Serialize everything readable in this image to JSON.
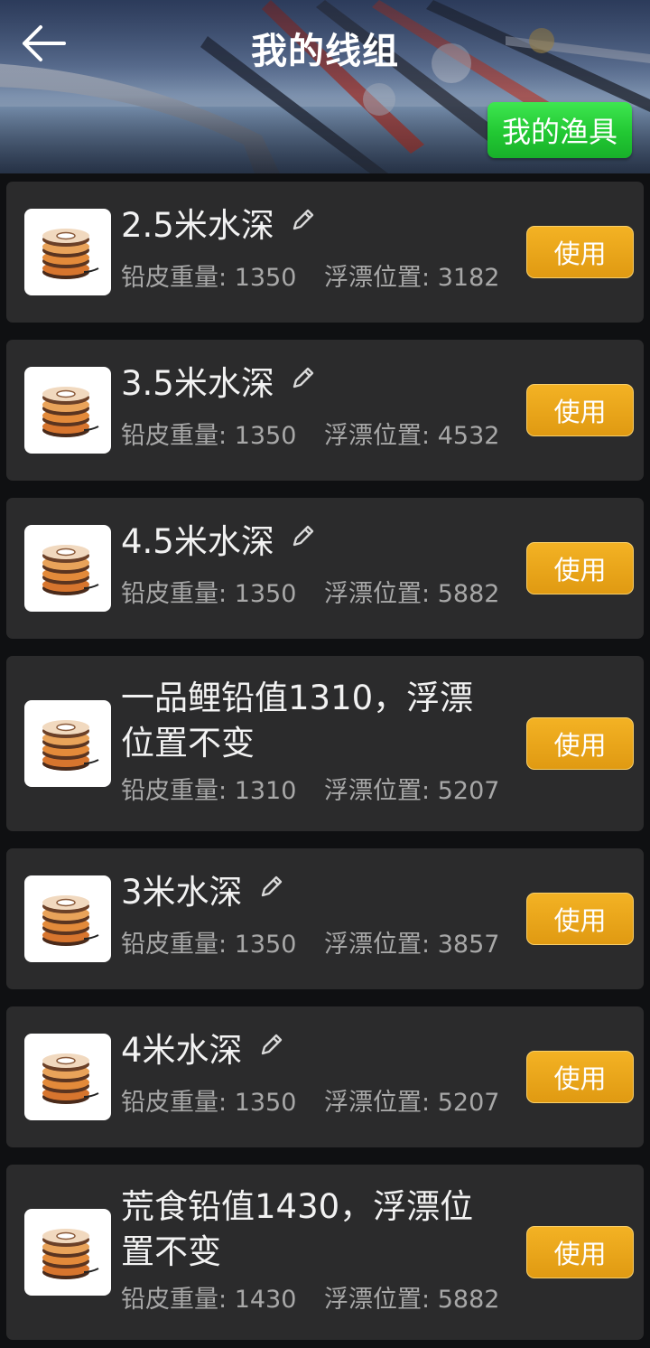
{
  "header": {
    "title": "我的线组",
    "back_icon": "arrow-left-icon",
    "gear_button_label": "我的渔具",
    "gear_button_color": "#22c833"
  },
  "colors": {
    "card_bg": "#2b2b2c",
    "use_button": "#e8a618",
    "title_text": "#f2f2f2",
    "info_text": "#a8a8a8"
  },
  "labels": {
    "weight_label": "铅皮重量:",
    "float_label": "浮漂位置:",
    "use_label": "使用"
  },
  "line_sets": [
    {
      "name": "2.5米水深",
      "weight": "1350",
      "float": "3182",
      "editable": true
    },
    {
      "name": "3.5米水深",
      "weight": "1350",
      "float": "4532",
      "editable": true
    },
    {
      "name": "4.5米水深",
      "weight": "1350",
      "float": "5882",
      "editable": true
    },
    {
      "name": "一品鲤铅值1310，浮漂位置不变",
      "weight": "1310",
      "float": "5207",
      "editable": false
    },
    {
      "name": "3米水深",
      "weight": "1350",
      "float": "3857",
      "editable": true
    },
    {
      "name": "4米水深",
      "weight": "1350",
      "float": "5207",
      "editable": true
    },
    {
      "name": "荒食铅值1430，浮漂位置不变",
      "weight": "1430",
      "float": "5882",
      "editable": false
    }
  ]
}
